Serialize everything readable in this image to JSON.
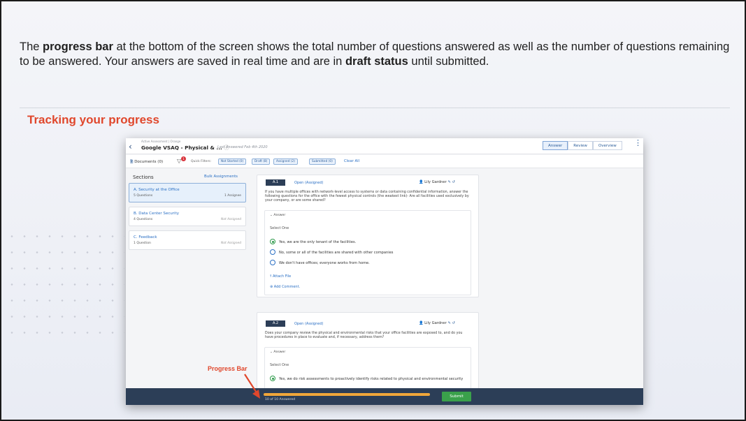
{
  "slide": {
    "intro_1": "The ",
    "intro_bold_1": "progress bar",
    "intro_2": " at the bottom of the screen shows the total number of questions answered as well as the number of questions remaining to be answered. Your answers are saved in real time and are in ",
    "intro_bold_2": "draft status",
    "intro_3": " until submitted.",
    "section_title": "Tracking your progress",
    "callout_label": "Progress Bar",
    "accent_color": "#e0472c"
  },
  "app": {
    "breadcrumb": "Active Assessment | Orange",
    "title": "Google VSAQ - Physical & ...",
    "last_answered": "Last Answered Feb 4th 2020",
    "tabs": [
      "Answer",
      "Review",
      "Overview"
    ],
    "documents_label": "Documents (0)",
    "filter_count": "1",
    "quick_filters_label": "Quick Filters:",
    "chips": [
      "Not Started (0)",
      "Draft (8)",
      "Assigned (2)",
      "Submitted (0)"
    ],
    "clear_all": "Clear All",
    "sections_heading": "Sections",
    "bulk_assignments": "Bulk Assignments",
    "sections": [
      {
        "name": "A. Security at the Office",
        "questions": "5 Questions",
        "assignee": "1 Assignee"
      },
      {
        "name": "B. Data Center Security",
        "questions": "4 Questions",
        "assignee": "Not Assigned"
      },
      {
        "name": "C. Feedback",
        "questions": "1 Question",
        "assignee": "Not Assigned"
      }
    ],
    "q1": {
      "id": "A.1",
      "status": "Open (Assigned)",
      "assignee": "Lily Gardner",
      "text": "If you have multiple offices with network-level access to systems or data containing confidential information, answer the following questions for the office with the fewest physical controls (the weakest link)- Are all facilities used exclusively by your company, or are some shared?",
      "answer_label": "Answer",
      "select_one": "Select One",
      "options": [
        "Yes, we are the only tenant of the facilities.",
        "No, some or all of the facilities are shared with other companies",
        "We don't have offices; everyone works from home."
      ],
      "attach_file": "Attach File",
      "add_comment": "Add Comment."
    },
    "q2": {
      "id": "A.2",
      "status": "Open (Assigned)",
      "assignee": "Lily Gardner",
      "text": "Does your company review the physical and environmental risks that your office facilities are exposed to, and do you have procedures in place to evaluate and, if necessary, address them?",
      "answer_label": "Answer",
      "select_one": "Select One",
      "option_1": "Yes, we do risk assessments to proactively identify risks related to physical and environmental security"
    },
    "progress": {
      "text": "10 of 10 Answered",
      "fraction": 1.0
    },
    "submit": "Submit"
  }
}
